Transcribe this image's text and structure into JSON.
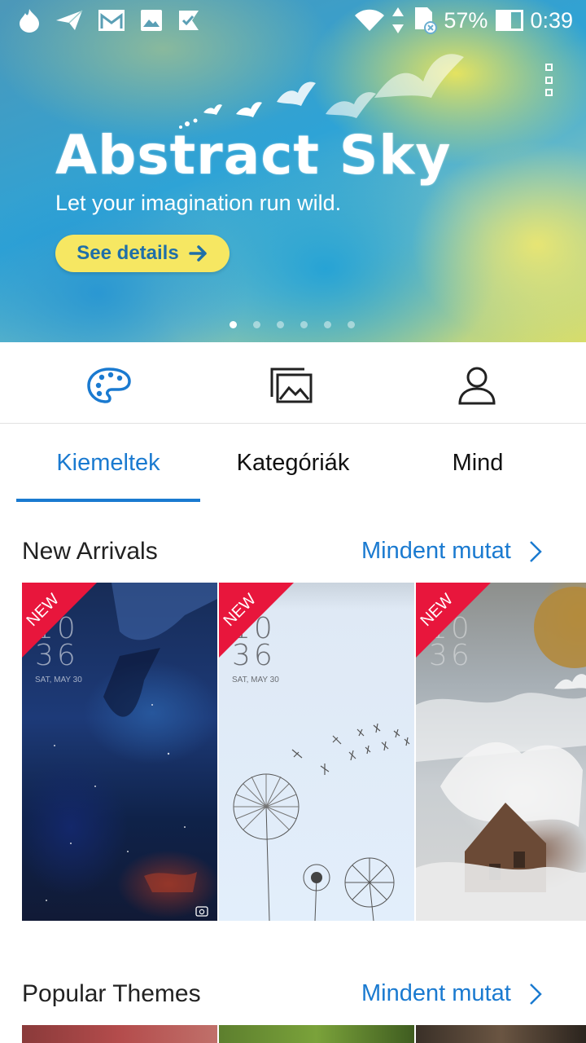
{
  "status_bar": {
    "battery_percent": "57%",
    "time": "0:39",
    "battery_level": 0.57,
    "left_icons": [
      "flame-icon",
      "send-icon",
      "gmail-icon",
      "image-icon",
      "check-flag-icon"
    ],
    "right_icons": [
      "wifi-icon",
      "data-arrows-icon",
      "sd-card-icon",
      "battery-icon"
    ]
  },
  "banner": {
    "title": "Abstract Sky",
    "subtitle": "Let your imagination run wild.",
    "cta_label": "See details",
    "slide_count": 6,
    "active_slide": 1,
    "colors": {
      "cta_bg": "#f6e762",
      "cta_text": "#1f6fa8"
    }
  },
  "icon_nav": [
    {
      "name": "themes",
      "icon": "palette-icon",
      "active": true
    },
    {
      "name": "wallpapers",
      "icon": "wallpapers-icon",
      "active": false
    },
    {
      "name": "profile",
      "icon": "user-icon",
      "active": false
    }
  ],
  "tabs": [
    {
      "label": "Kiemeltek",
      "active": true
    },
    {
      "label": "Kategóriák",
      "active": false
    },
    {
      "label": "Mind",
      "active": false
    }
  ],
  "sections": {
    "new_arrivals": {
      "title": "New Arrivals",
      "show_all": "Mindent mutat",
      "cards": [
        {
          "badge": "NEW",
          "clock_hour": "10",
          "clock_min": "36",
          "date": "SAT, MAY 30",
          "theme": "dark-space"
        },
        {
          "badge": "NEW",
          "clock_hour": "10",
          "clock_min": "36",
          "date": "SAT, MAY 30",
          "theme": "dandelion"
        },
        {
          "badge": "NEW",
          "clock_hour": "10",
          "clock_min": "36",
          "theme": "angel-house"
        }
      ]
    },
    "popular_themes": {
      "title": "Popular Themes",
      "show_all": "Mindent mutat"
    }
  },
  "colors": {
    "accent": "#1a7ad0",
    "badge": "#e8163c"
  }
}
